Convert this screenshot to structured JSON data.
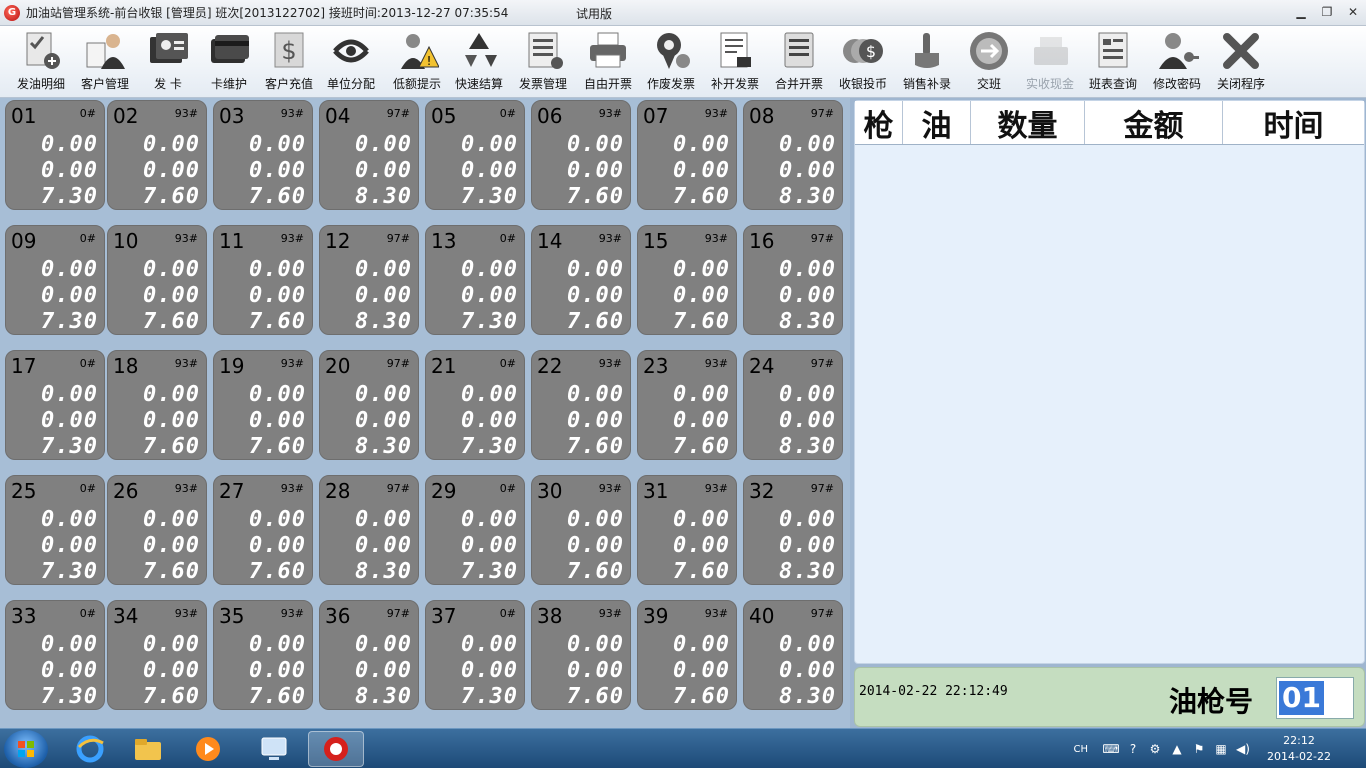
{
  "window": {
    "title": "加油站管理系统-前台收银  [管理员]  班次[2013122702]  接班时间:2013-12-27 07:35:54",
    "edition": "试用版",
    "buttons": [
      "minimize",
      "maximize",
      "close"
    ]
  },
  "toolbar": [
    {
      "label": "发油明细",
      "icon": "checklist-pen-icon",
      "enabled": true
    },
    {
      "label": "客户管理",
      "icon": "customer-person-icon",
      "enabled": true
    },
    {
      "label": "发  卡",
      "icon": "id-card-icon",
      "enabled": true
    },
    {
      "label": "卡维护",
      "icon": "card-stack-icon",
      "enabled": true
    },
    {
      "label": "客户充值",
      "icon": "dollar-note-icon",
      "enabled": true
    },
    {
      "label": "单位分配",
      "icon": "split-arrows-icon",
      "enabled": true
    },
    {
      "label": "低额提示",
      "icon": "warning-person-icon",
      "enabled": true
    },
    {
      "label": "快速结算",
      "icon": "recycle-icon",
      "enabled": true
    },
    {
      "label": "发票管理",
      "icon": "document-list-icon",
      "enabled": true
    },
    {
      "label": "自由开票",
      "icon": "printer-icon",
      "enabled": true
    },
    {
      "label": "作废发票",
      "icon": "void-badge-icon",
      "enabled": true
    },
    {
      "label": "补开发票",
      "icon": "receipt-icon",
      "enabled": true
    },
    {
      "label": "合并开票",
      "icon": "merge-doc-icon",
      "enabled": true
    },
    {
      "label": "收银投币",
      "icon": "coin-stack-icon",
      "enabled": true
    },
    {
      "label": "销售补录",
      "icon": "hand-pointer-icon",
      "enabled": true
    },
    {
      "label": "交班",
      "icon": "shift-swap-icon",
      "enabled": true
    },
    {
      "label": "实收现金",
      "icon": "cash-register-icon",
      "enabled": false
    },
    {
      "label": "班表查询",
      "icon": "report-icon",
      "enabled": true
    },
    {
      "label": "修改密码",
      "icon": "user-key-icon",
      "enabled": true
    },
    {
      "label": "关闭程序",
      "icon": "close-x-icon",
      "enabled": true
    }
  ],
  "pumps": [
    {
      "num": "01",
      "oil": "0#",
      "v1": "0.00",
      "v2": "0.00",
      "v3": "7.30"
    },
    {
      "num": "02",
      "oil": "93#",
      "v1": "0.00",
      "v2": "0.00",
      "v3": "7.60"
    },
    {
      "num": "03",
      "oil": "93#",
      "v1": "0.00",
      "v2": "0.00",
      "v3": "7.60"
    },
    {
      "num": "04",
      "oil": "97#",
      "v1": "0.00",
      "v2": "0.00",
      "v3": "8.30"
    },
    {
      "num": "05",
      "oil": "0#",
      "v1": "0.00",
      "v2": "0.00",
      "v3": "7.30"
    },
    {
      "num": "06",
      "oil": "93#",
      "v1": "0.00",
      "v2": "0.00",
      "v3": "7.60"
    },
    {
      "num": "07",
      "oil": "93#",
      "v1": "0.00",
      "v2": "0.00",
      "v3": "7.60"
    },
    {
      "num": "08",
      "oil": "97#",
      "v1": "0.00",
      "v2": "0.00",
      "v3": "8.30"
    },
    {
      "num": "09",
      "oil": "0#",
      "v1": "0.00",
      "v2": "0.00",
      "v3": "7.30"
    },
    {
      "num": "10",
      "oil": "93#",
      "v1": "0.00",
      "v2": "0.00",
      "v3": "7.60"
    },
    {
      "num": "11",
      "oil": "93#",
      "v1": "0.00",
      "v2": "0.00",
      "v3": "7.60"
    },
    {
      "num": "12",
      "oil": "97#",
      "v1": "0.00",
      "v2": "0.00",
      "v3": "8.30"
    },
    {
      "num": "13",
      "oil": "0#",
      "v1": "0.00",
      "v2": "0.00",
      "v3": "7.30"
    },
    {
      "num": "14",
      "oil": "93#",
      "v1": "0.00",
      "v2": "0.00",
      "v3": "7.60"
    },
    {
      "num": "15",
      "oil": "93#",
      "v1": "0.00",
      "v2": "0.00",
      "v3": "7.60"
    },
    {
      "num": "16",
      "oil": "97#",
      "v1": "0.00",
      "v2": "0.00",
      "v3": "8.30"
    },
    {
      "num": "17",
      "oil": "0#",
      "v1": "0.00",
      "v2": "0.00",
      "v3": "7.30"
    },
    {
      "num": "18",
      "oil": "93#",
      "v1": "0.00",
      "v2": "0.00",
      "v3": "7.60"
    },
    {
      "num": "19",
      "oil": "93#",
      "v1": "0.00",
      "v2": "0.00",
      "v3": "7.60"
    },
    {
      "num": "20",
      "oil": "97#",
      "v1": "0.00",
      "v2": "0.00",
      "v3": "8.30"
    },
    {
      "num": "21",
      "oil": "0#",
      "v1": "0.00",
      "v2": "0.00",
      "v3": "7.30"
    },
    {
      "num": "22",
      "oil": "93#",
      "v1": "0.00",
      "v2": "0.00",
      "v3": "7.60"
    },
    {
      "num": "23",
      "oil": "93#",
      "v1": "0.00",
      "v2": "0.00",
      "v3": "7.60"
    },
    {
      "num": "24",
      "oil": "97#",
      "v1": "0.00",
      "v2": "0.00",
      "v3": "8.30"
    },
    {
      "num": "25",
      "oil": "0#",
      "v1": "0.00",
      "v2": "0.00",
      "v3": "7.30"
    },
    {
      "num": "26",
      "oil": "93#",
      "v1": "0.00",
      "v2": "0.00",
      "v3": "7.60"
    },
    {
      "num": "27",
      "oil": "93#",
      "v1": "0.00",
      "v2": "0.00",
      "v3": "7.60"
    },
    {
      "num": "28",
      "oil": "97#",
      "v1": "0.00",
      "v2": "0.00",
      "v3": "8.30"
    },
    {
      "num": "29",
      "oil": "0#",
      "v1": "0.00",
      "v2": "0.00",
      "v3": "7.30"
    },
    {
      "num": "30",
      "oil": "93#",
      "v1": "0.00",
      "v2": "0.00",
      "v3": "7.60"
    },
    {
      "num": "31",
      "oil": "93#",
      "v1": "0.00",
      "v2": "0.00",
      "v3": "7.60"
    },
    {
      "num": "32",
      "oil": "97#",
      "v1": "0.00",
      "v2": "0.00",
      "v3": "8.30"
    },
    {
      "num": "33",
      "oil": "0#",
      "v1": "0.00",
      "v2": "0.00",
      "v3": "7.30"
    },
    {
      "num": "34",
      "oil": "93#",
      "v1": "0.00",
      "v2": "0.00",
      "v3": "7.60"
    },
    {
      "num": "35",
      "oil": "93#",
      "v1": "0.00",
      "v2": "0.00",
      "v3": "7.60"
    },
    {
      "num": "36",
      "oil": "97#",
      "v1": "0.00",
      "v2": "0.00",
      "v3": "8.30"
    },
    {
      "num": "37",
      "oil": "0#",
      "v1": "0.00",
      "v2": "0.00",
      "v3": "7.30"
    },
    {
      "num": "38",
      "oil": "93#",
      "v1": "0.00",
      "v2": "0.00",
      "v3": "7.60"
    },
    {
      "num": "39",
      "oil": "93#",
      "v1": "0.00",
      "v2": "0.00",
      "v3": "7.60"
    },
    {
      "num": "40",
      "oil": "97#",
      "v1": "0.00",
      "v2": "0.00",
      "v3": "8.30"
    }
  ],
  "record_table": {
    "columns": [
      "枪",
      "油",
      "数量",
      "金额",
      "时间"
    ],
    "rows": []
  },
  "info": {
    "datetime": "2014-02-22  22:12:49",
    "gun_label": "油枪号",
    "gun_value": "01"
  },
  "taskbar": {
    "apps": [
      "internet-explorer-icon",
      "file-explorer-icon",
      "media-player-icon",
      "remote-desktop-icon",
      "gas-station-app-icon"
    ],
    "lang": "CH",
    "time": "22:12",
    "date": "2014-02-22"
  },
  "colors": {
    "pump_face": "#808080",
    "grid_bg": "#a7bed6",
    "info_bg": "#c5ddc0",
    "selection": "#3a79d8",
    "taskbar": "#1d4a77"
  }
}
